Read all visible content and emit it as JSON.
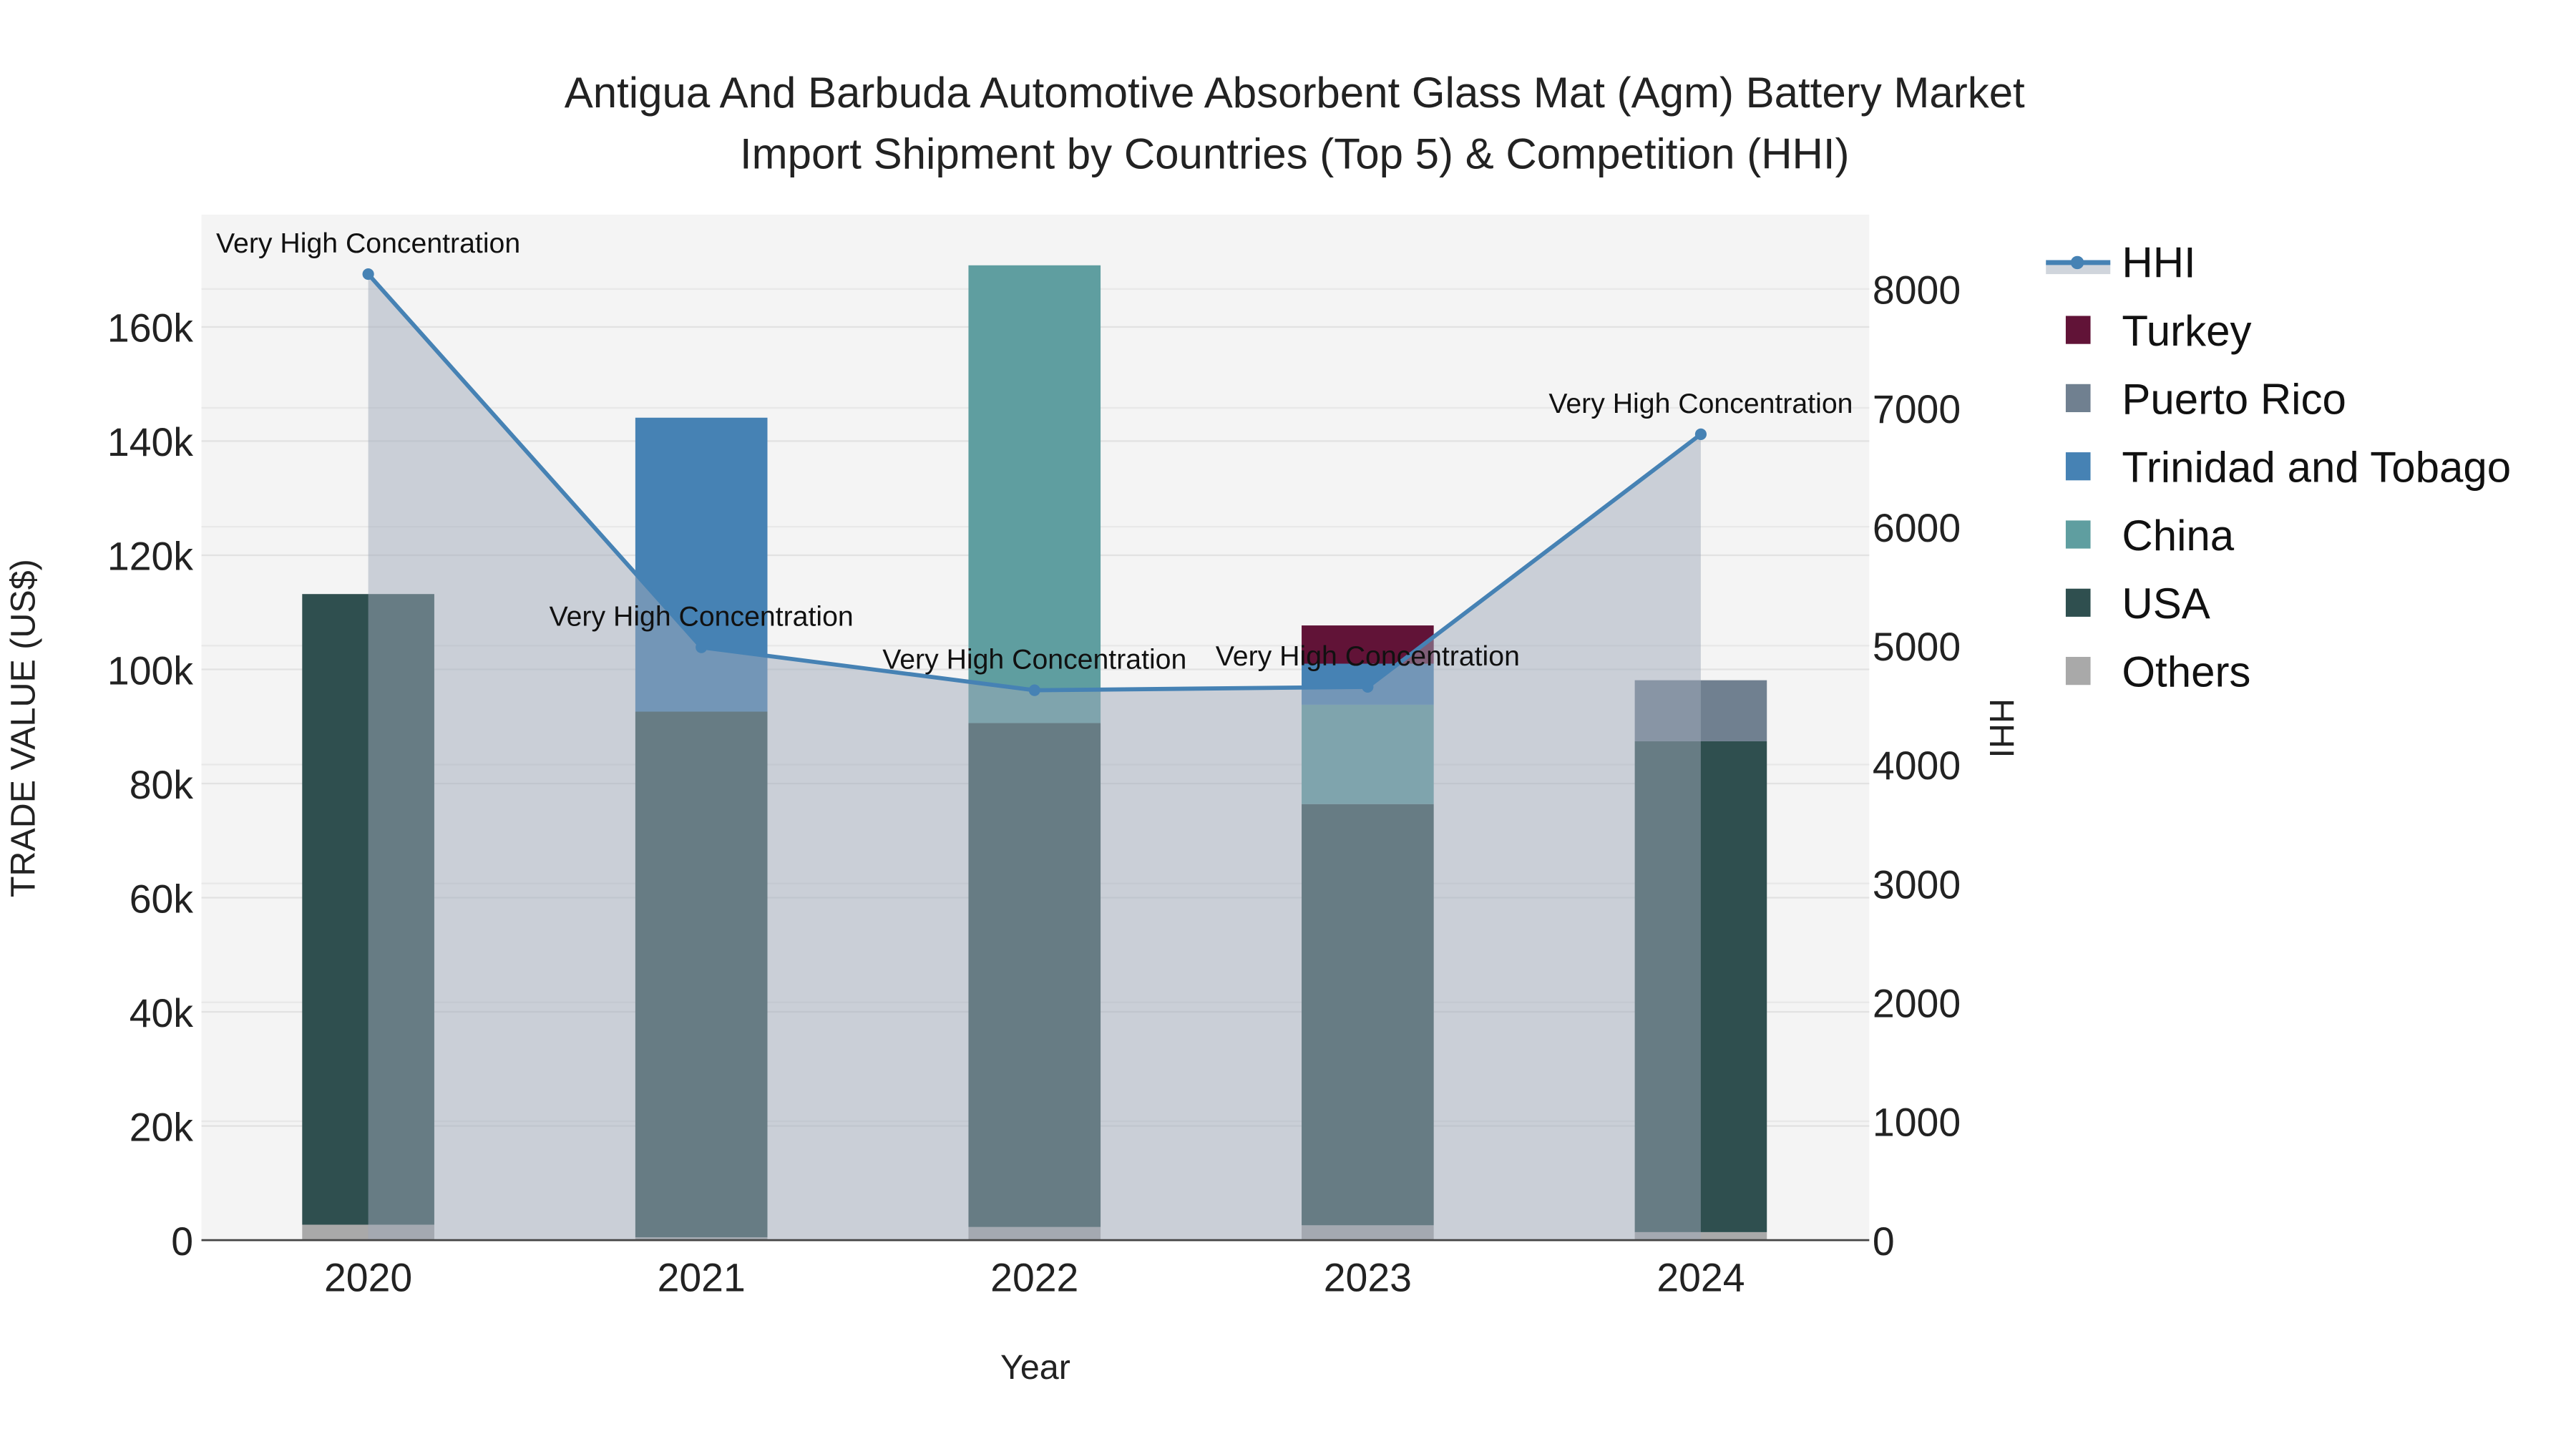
{
  "chart_data": {
    "type": "bar",
    "title_line1": "Antigua And Barbuda Automotive Absorbent Glass Mat (Agm) Battery Market",
    "title_line2": "Import Shipment by Countries (Top 5) & Competition (HHI)",
    "xlabel": "Year",
    "ylabel": "TRADE VALUE (US$)",
    "y2label": "HHI",
    "categories": [
      "2020",
      "2021",
      "2022",
      "2023",
      "2024"
    ],
    "ylim": [
      0,
      180000
    ],
    "y2lim": [
      0,
      8600
    ],
    "yticks": [
      0,
      20000,
      40000,
      60000,
      80000,
      100000,
      120000,
      140000,
      160000
    ],
    "ytick_labels": [
      "0",
      "20k",
      "40k",
      "60k",
      "80k",
      "100k",
      "120k",
      "140k",
      "160k"
    ],
    "y2ticks": [
      0,
      1000,
      2000,
      3000,
      4000,
      5000,
      6000,
      7000,
      8000
    ],
    "y2tick_labels": [
      "0",
      "1000",
      "2000",
      "3000",
      "4000",
      "5000",
      "6000",
      "7000",
      "8000"
    ],
    "stacked": true,
    "series": [
      {
        "name": "Others",
        "color": "#a9a9a9",
        "values": [
          2700,
          500,
          2300,
          2600,
          1400
        ]
      },
      {
        "name": "USA",
        "color": "#2f4f4f",
        "values": [
          110500,
          92100,
          88300,
          73800,
          86000
        ]
      },
      {
        "name": "China",
        "color": "#5f9ea0",
        "values": [
          0,
          0,
          80200,
          17400,
          0
        ]
      },
      {
        "name": "Trinidad and Tobago",
        "color": "#4682b4",
        "values": [
          0,
          51500,
          0,
          7200,
          0
        ]
      },
      {
        "name": "Puerto Rico",
        "color": "#708090",
        "values": [
          0,
          0,
          0,
          0,
          10700
        ]
      },
      {
        "name": "Turkey",
        "color": "#611337",
        "values": [
          0,
          0,
          0,
          6700,
          0
        ]
      }
    ],
    "hhi": {
      "name": "HHI",
      "color": "#4682b4",
      "values": [
        8125,
        4986,
        4625,
        4653,
        6778
      ]
    },
    "annotations": [
      "Very High Concentration",
      "Very High Concentration",
      "Very High Concentration",
      "Very High Concentration",
      "Very High Concentration"
    ],
    "legend_order": [
      "HHI",
      "Turkey",
      "Puerto Rico",
      "Trinidad and Tobago",
      "China",
      "USA",
      "Others"
    ],
    "legend_position": "right",
    "grid": true
  }
}
